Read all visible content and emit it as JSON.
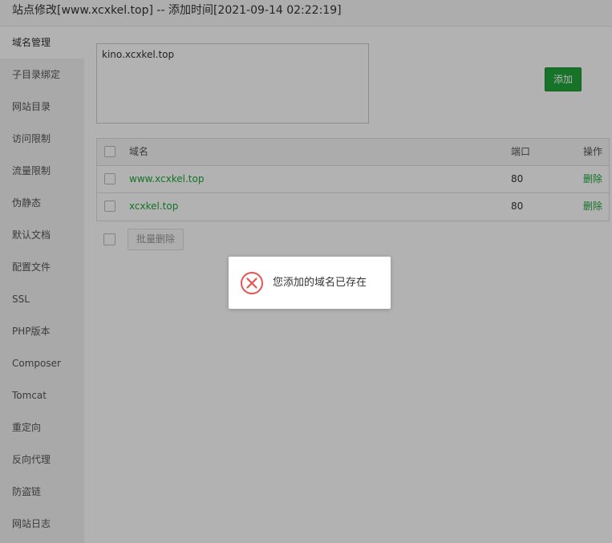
{
  "title": "站点修改[www.xcxkel.top] -- 添加时间[2021-09-14 02:22:19]",
  "sidebar": {
    "items": [
      {
        "label": "域名管理",
        "active": true
      },
      {
        "label": "子目录绑定"
      },
      {
        "label": "网站目录"
      },
      {
        "label": "访问限制"
      },
      {
        "label": "流量限制"
      },
      {
        "label": "伪静态"
      },
      {
        "label": "默认文档"
      },
      {
        "label": "配置文件"
      },
      {
        "label": "SSL"
      },
      {
        "label": "PHP版本"
      },
      {
        "label": "Composer"
      },
      {
        "label": "Tomcat"
      },
      {
        "label": "重定向"
      },
      {
        "label": "反向代理"
      },
      {
        "label": "防盗链"
      },
      {
        "label": "网站日志"
      }
    ]
  },
  "domain_input": {
    "value": "kino.xcxkel.top"
  },
  "add_button": {
    "label": "添加"
  },
  "table": {
    "headers": {
      "name": "域名",
      "port": "端口",
      "op": "操作"
    },
    "rows": [
      {
        "domain": "www.xcxkel.top",
        "port": "80",
        "action": "删除"
      },
      {
        "domain": "xcxkel.top",
        "port": "80",
        "action": "删除"
      }
    ]
  },
  "batch_delete": {
    "label": "批量删除"
  },
  "message": {
    "text": "您添加的域名已存在",
    "icon": "error-circle-icon"
  },
  "colors": {
    "accent": "#20a53a",
    "error": "#e8544f"
  }
}
